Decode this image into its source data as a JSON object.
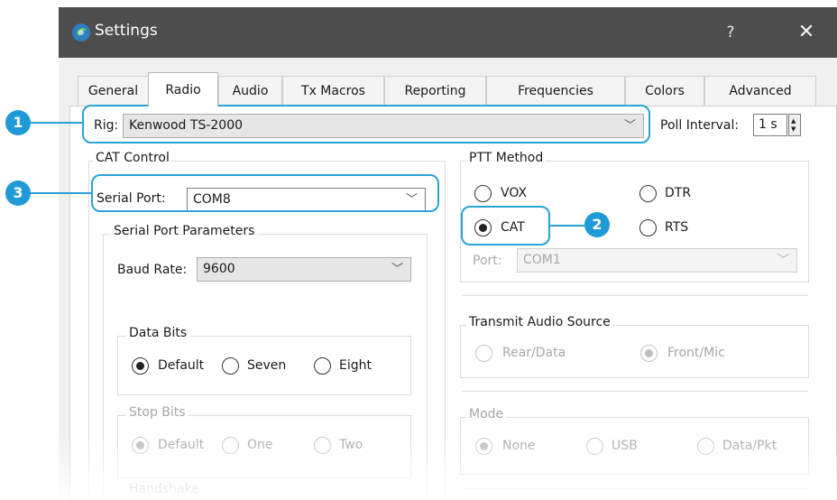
{
  "window": {
    "title": "Settings",
    "help_label": "?",
    "close_label": "✕"
  },
  "tabs": [
    {
      "label": "General"
    },
    {
      "label": "Radio",
      "active": true
    },
    {
      "label": "Audio"
    },
    {
      "label": "Tx Macros"
    },
    {
      "label": "Reporting"
    },
    {
      "label": "Frequencies"
    },
    {
      "label": "Colors"
    },
    {
      "label": "Advanced"
    }
  ],
  "rig": {
    "label": "Rig:",
    "value": "Kenwood TS-2000",
    "poll_interval_label": "Poll Interval:",
    "poll_interval_value": "1 s"
  },
  "cat_control": {
    "title": "CAT Control",
    "serial_port_label": "Serial Port:",
    "serial_port_value": "COM8",
    "serial_params_title": "Serial Port Parameters",
    "baud_rate_label": "Baud Rate:",
    "baud_rate_value": "9600",
    "data_bits": {
      "title": "Data Bits",
      "options": [
        "Default",
        "Seven",
        "Eight"
      ],
      "selected": "Default"
    },
    "stop_bits": {
      "title": "Stop Bits",
      "options": [
        "Default",
        "One",
        "Two"
      ],
      "selected": "Default"
    },
    "handshake_title": "Handshake"
  },
  "ptt_method": {
    "title": "PTT Method",
    "options": [
      "VOX",
      "DTR",
      "CAT",
      "RTS"
    ],
    "selected": "CAT",
    "port_label": "Port:",
    "port_value": "COM1"
  },
  "transmit_audio_source": {
    "title": "Transmit Audio Source",
    "options": [
      "Rear/Data",
      "Front/Mic"
    ],
    "selected": "Front/Mic"
  },
  "mode": {
    "title": "Mode",
    "options": [
      "None",
      "USB",
      "Data/Pkt"
    ],
    "selected": "None"
  },
  "callouts": [
    "1",
    "2",
    "3"
  ],
  "colors": {
    "titlebar": "#4d4d4d",
    "callout_accent": "#1e9ad6"
  }
}
